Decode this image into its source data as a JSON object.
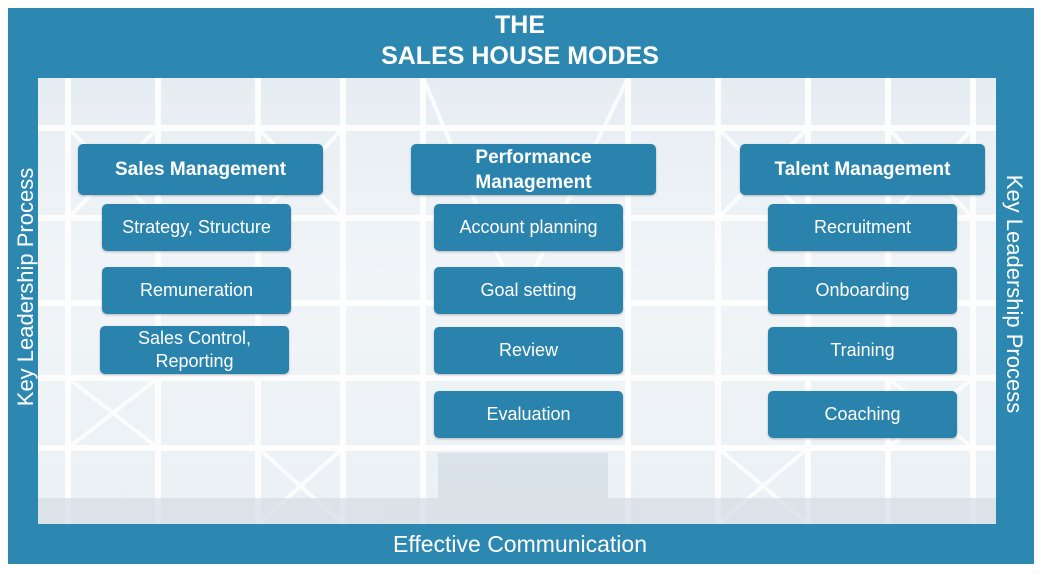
{
  "title": {
    "line1": "THE",
    "line2": "SALES HOUSE MODES"
  },
  "side_label_left": "Key Leadership Process",
  "side_label_right": "Key Leadership Process",
  "footer": "Effective Communication",
  "columns": [
    {
      "heading": "Sales Management",
      "items": [
        "Strategy, Structure",
        "Remuneration",
        "Sales Control,\nReporting"
      ]
    },
    {
      "heading": "Performance\nManagement",
      "items": [
        "Account planning",
        "Goal setting",
        "Review",
        "Evaluation"
      ]
    },
    {
      "heading": "Talent Management",
      "items": [
        "Recruitment",
        "Onboarding",
        "Training",
        "Coaching"
      ]
    }
  ],
  "colors": {
    "frame": "#2c87b1",
    "box": "#2a83ac",
    "text": "#ffffff"
  }
}
